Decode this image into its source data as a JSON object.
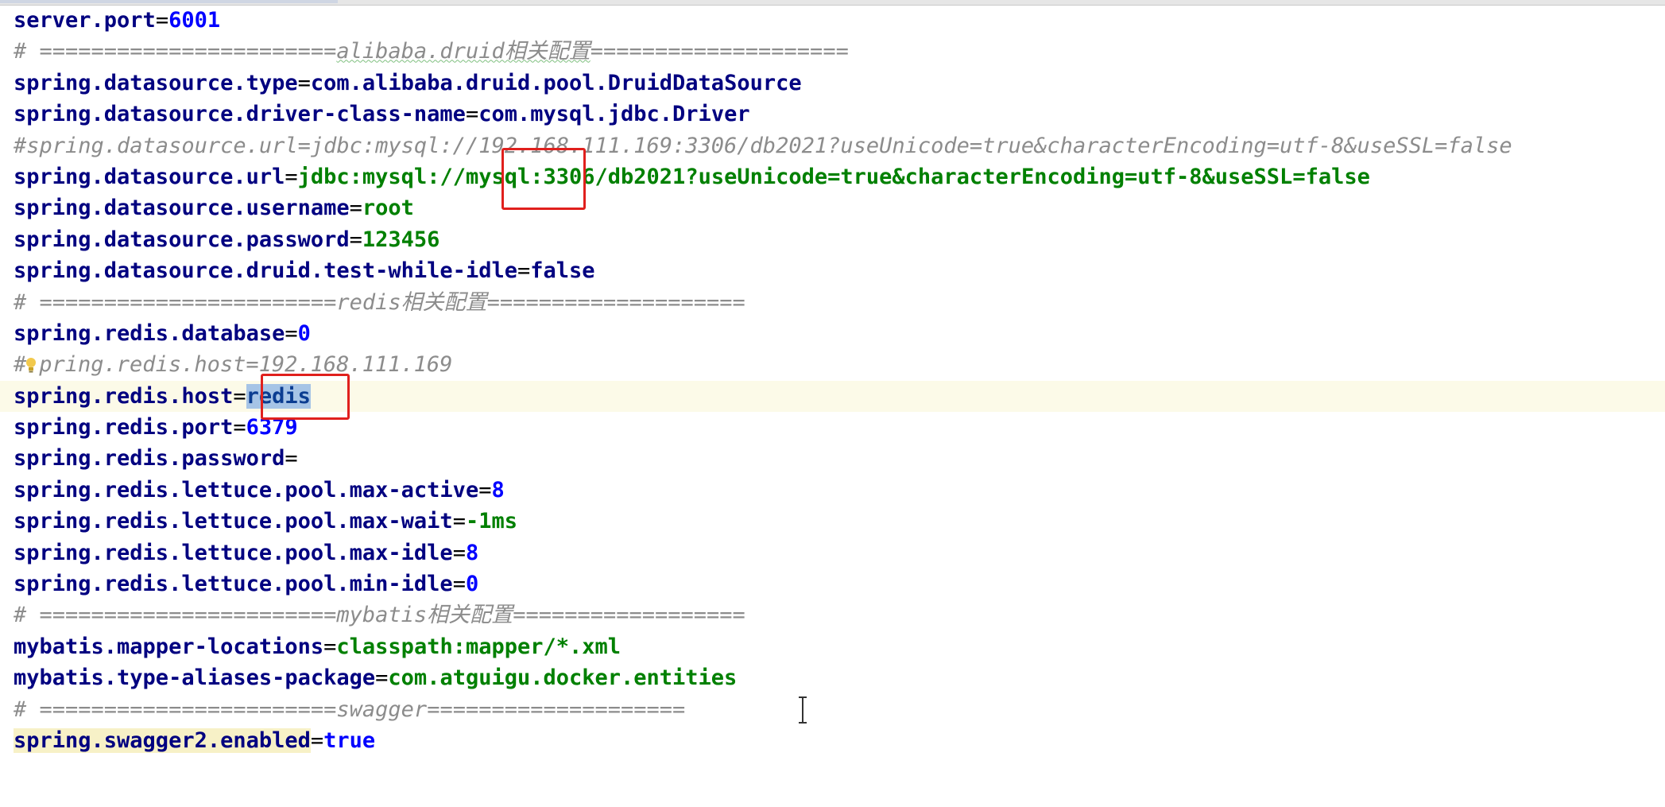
{
  "editor": {
    "lines": [
      {
        "key": "server.port",
        "value": "6001"
      },
      {
        "comment_prefix": "# =======================",
        "comment_label": "alibaba.druid相关配置",
        "comment_suffix": "===================="
      },
      {
        "key": "spring.datasource.type",
        "value": "com.alibaba.druid.pool.DruidDataSource"
      },
      {
        "key": "spring.datasource.driver-class-name",
        "value": "com.mysql.jdbc.Driver"
      },
      {
        "comment": "#spring.datasource.url=jdbc:mysql://192.168.111.169:3306/db2021?useUnicode=true&characterEncoding=utf-8&useSSL=false"
      },
      {
        "key": "spring.datasource.url",
        "value_a": "jdbc:mysql://",
        "value_b": "mysql",
        "value_c": ":3306/db2021?useUnicode=true&characterEncoding=utf-8&useSSL=false"
      },
      {
        "key": "spring.datasource.username",
        "value": "root"
      },
      {
        "key": "spring.datasource.password",
        "value": "123456"
      },
      {
        "key": "spring.datasource.druid.test-while-idle",
        "value": "false"
      },
      {
        "comment_prefix": "# =======================",
        "comment_label": "redis相关配置",
        "comment_suffix": "===================="
      },
      {
        "key": "spring.redis.database",
        "value": "0"
      },
      {
        "comment_a": "#",
        "comment_b": "pring.redis.host=192.168.111.169"
      },
      {
        "key": "spring.redis.host",
        "value": "redis"
      },
      {
        "key": "spring.redis.port",
        "value": "6379"
      },
      {
        "key": "spring.redis.password",
        "value": ""
      },
      {
        "key": "spring.redis.lettuce.pool.max-active",
        "value": "8"
      },
      {
        "key": "spring.redis.lettuce.pool.max-wait",
        "value": "-1ms"
      },
      {
        "key": "spring.redis.lettuce.pool.max-idle",
        "value": "8"
      },
      {
        "key": "spring.redis.lettuce.pool.min-idle",
        "value": "0"
      },
      {
        "comment_prefix": "# =======================",
        "comment_label": "mybatis相关配置",
        "comment_suffix": "=================="
      },
      {
        "key": "mybatis.mapper-locations",
        "value": "classpath:mapper/*.xml"
      },
      {
        "key": "mybatis.type-aliases-package",
        "value": "com.atguigu.docker.entities"
      },
      {
        "comment_prefix": "# =======================",
        "comment_label": "swagger",
        "comment_suffix": "===================="
      },
      {
        "key": "spring.swagger2.enabled",
        "value": "true"
      }
    ]
  },
  "colors": {
    "key": "#000080",
    "number": "#0000ff",
    "string": "#008000",
    "comment": "#8c8c8c",
    "highlight_box": "#e0201d",
    "selection": "#a6c4e6",
    "current_line": "#fcfae8"
  },
  "icons": {
    "intention_bulb": "lightbulb-icon",
    "text_cursor": "i-beam-cursor-icon"
  }
}
